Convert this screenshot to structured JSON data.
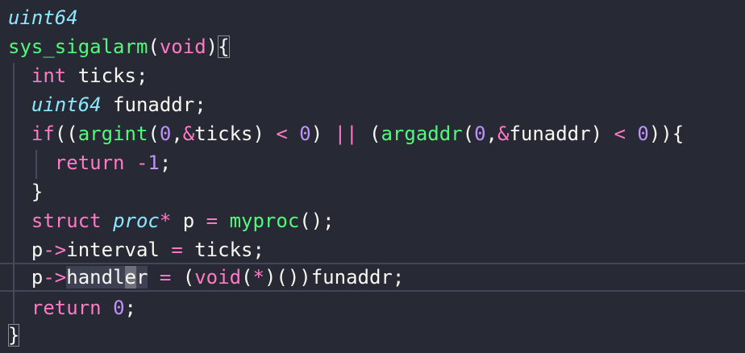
{
  "editor": {
    "lines": [
      [
        {
          "t": "uint64",
          "c": "type-it"
        }
      ],
      [
        {
          "t": "sys_sigalarm",
          "c": "fn"
        },
        {
          "t": "(",
          "c": "pl"
        },
        {
          "t": "void",
          "c": "kw"
        },
        {
          "t": ")",
          "c": "pl"
        },
        {
          "t": "{",
          "c": "pl",
          "m": "bracket-match"
        }
      ],
      [
        {
          "t": "  ",
          "c": "pl"
        },
        {
          "t": "int",
          "c": "kw"
        },
        {
          "t": " ticks;",
          "c": "pl"
        }
      ],
      [
        {
          "t": "  ",
          "c": "pl"
        },
        {
          "t": "uint64",
          "c": "type-it"
        },
        {
          "t": " funaddr;",
          "c": "pl"
        }
      ],
      [
        {
          "t": "  ",
          "c": "pl"
        },
        {
          "t": "if",
          "c": "kw"
        },
        {
          "t": "((",
          "c": "pl"
        },
        {
          "t": "argint",
          "c": "fn"
        },
        {
          "t": "(",
          "c": "pl"
        },
        {
          "t": "0",
          "c": "num"
        },
        {
          "t": ",",
          "c": "pl"
        },
        {
          "t": "&",
          "c": "kw"
        },
        {
          "t": "ticks) ",
          "c": "pl"
        },
        {
          "t": "<",
          "c": "kw"
        },
        {
          "t": " ",
          "c": "pl"
        },
        {
          "t": "0",
          "c": "num"
        },
        {
          "t": ") ",
          "c": "pl"
        },
        {
          "t": "||",
          "c": "kw"
        },
        {
          "t": " (",
          "c": "pl"
        },
        {
          "t": "argaddr",
          "c": "fn"
        },
        {
          "t": "(",
          "c": "pl"
        },
        {
          "t": "0",
          "c": "num"
        },
        {
          "t": ",",
          "c": "pl"
        },
        {
          "t": "&",
          "c": "kw"
        },
        {
          "t": "funaddr) ",
          "c": "pl"
        },
        {
          "t": "<",
          "c": "kw"
        },
        {
          "t": " ",
          "c": "pl"
        },
        {
          "t": "0",
          "c": "num"
        },
        {
          "t": ")){",
          "c": "pl"
        }
      ],
      [
        {
          "t": "    ",
          "c": "pl"
        },
        {
          "t": "return",
          "c": "kw"
        },
        {
          "t": " ",
          "c": "pl"
        },
        {
          "t": "-",
          "c": "kw"
        },
        {
          "t": "1",
          "c": "num"
        },
        {
          "t": ";",
          "c": "pl"
        }
      ],
      [
        {
          "t": "  }",
          "c": "pl"
        }
      ],
      [
        {
          "t": "  ",
          "c": "pl"
        },
        {
          "t": "struct",
          "c": "kw"
        },
        {
          "t": " ",
          "c": "pl"
        },
        {
          "t": "proc",
          "c": "type-it"
        },
        {
          "t": "*",
          "c": "kw"
        },
        {
          "t": " p ",
          "c": "pl"
        },
        {
          "t": "=",
          "c": "kw"
        },
        {
          "t": " ",
          "c": "pl"
        },
        {
          "t": "myproc",
          "c": "fn"
        },
        {
          "t": "();",
          "c": "pl"
        }
      ],
      [
        {
          "t": "  p",
          "c": "pl"
        },
        {
          "t": "->",
          "c": "kw"
        },
        {
          "t": "interval ",
          "c": "pl"
        },
        {
          "t": "=",
          "c": "kw"
        },
        {
          "t": " ticks;",
          "c": "pl"
        }
      ],
      [
        {
          "t": "  p",
          "c": "pl"
        },
        {
          "t": "->",
          "c": "kw"
        },
        {
          "t": "handl",
          "c": "pl",
          "m": "sel-word"
        },
        {
          "t": "e",
          "c": "pl",
          "m": "cursor-box"
        },
        {
          "t": "r",
          "c": "pl",
          "m": "sel-word"
        },
        {
          "t": " ",
          "c": "pl"
        },
        {
          "t": "=",
          "c": "kw"
        },
        {
          "t": " (",
          "c": "pl"
        },
        {
          "t": "void",
          "c": "kw"
        },
        {
          "t": "(",
          "c": "pl"
        },
        {
          "t": "*",
          "c": "kw"
        },
        {
          "t": ")())funaddr;",
          "c": "pl"
        }
      ],
      [
        {
          "t": "  ",
          "c": "pl"
        },
        {
          "t": "return",
          "c": "kw"
        },
        {
          "t": " ",
          "c": "pl"
        },
        {
          "t": "0",
          "c": "num"
        },
        {
          "t": ";",
          "c": "pl"
        }
      ],
      [
        {
          "t": "}",
          "c": "pl",
          "m": "bracket-match"
        }
      ]
    ],
    "current_line_index": 9,
    "colors": {
      "background": "#272935",
      "plain": "#f8f8f2",
      "keyword": "#ff79c6",
      "function": "#50fa7b",
      "type": "#8be9fd",
      "number": "#bd93f9"
    }
  }
}
